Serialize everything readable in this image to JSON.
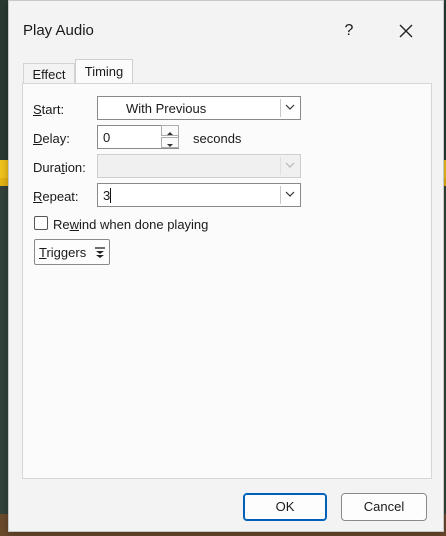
{
  "dialog": {
    "title": "Play Audio",
    "help_label": "?",
    "tabs": [
      {
        "label": "Effect",
        "selected": false
      },
      {
        "label": "Timing",
        "selected": true
      }
    ]
  },
  "timing": {
    "start": {
      "label": "Start:",
      "value": "With Previous"
    },
    "delay": {
      "label": "Delay:",
      "value": "0",
      "unit": "seconds"
    },
    "duration": {
      "label": "Duration:",
      "value": "",
      "disabled": true
    },
    "repeat": {
      "label": "Repeat:",
      "value": "3"
    },
    "rewind": {
      "label": "Rewind when done playing",
      "checked": false
    },
    "triggers_label": "Triggers"
  },
  "buttons": {
    "ok": "OK",
    "cancel": "Cancel"
  },
  "colors": {
    "accent": "#005fb8",
    "background_yellow": "#f2c21b"
  }
}
